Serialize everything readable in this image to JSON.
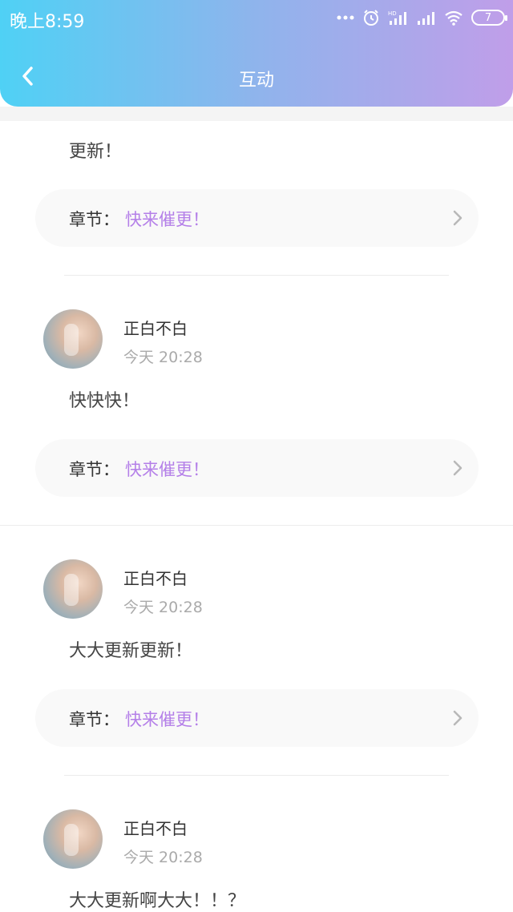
{
  "status_bar": {
    "time": "晚上8:59",
    "battery": "7",
    "icons": [
      "more-dots-icon",
      "alarm-icon",
      "hd-signal-icon",
      "signal-icon",
      "wifi-icon",
      "battery-icon"
    ]
  },
  "header": {
    "title": "互动",
    "back_icon": "chevron-left-icon"
  },
  "posts": [
    {
      "comment": "更新！",
      "chapter_label": "章节：",
      "chapter_value": "快来催更！"
    },
    {
      "username": "正白不白",
      "time": "今天 20:28",
      "comment": "快快快！",
      "chapter_label": "章节：",
      "chapter_value": "快来催更！"
    },
    {
      "username": "正白不白",
      "time": "今天 20:28",
      "comment": "大大更新更新！",
      "chapter_label": "章节：",
      "chapter_value": "快来催更！"
    },
    {
      "username": "正白不白",
      "time": "今天 20:28",
      "comment": "大大更新啊大大！！？"
    }
  ],
  "colors": {
    "gradient_start": "#4fd1f5",
    "gradient_end": "#c09ee9",
    "chapter_accent": "#b47fe8"
  }
}
